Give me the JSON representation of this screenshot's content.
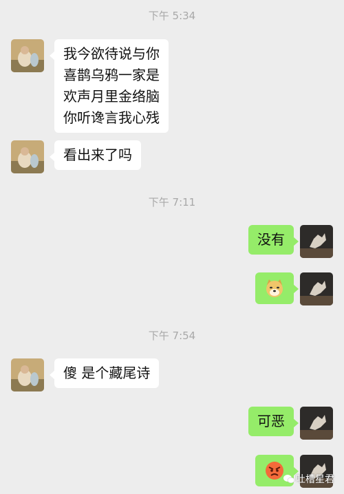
{
  "chat": {
    "timestamps": [
      "下午 5:34",
      "下午 7:11",
      "下午 7:54"
    ],
    "messages": [
      {
        "side": "in",
        "lines": [
          "我今欲待说与你",
          "喜鹊乌鸦一家是",
          "欢声月里金络脑",
          "你听谗言我心残"
        ]
      },
      {
        "side": "in",
        "lines": [
          "看出来了吗"
        ]
      },
      {
        "side": "out",
        "lines": [
          "没有"
        ]
      },
      {
        "side": "out",
        "sticker": "doge-emoji"
      },
      {
        "side": "in",
        "lines": [
          "傻 是个藏尾诗"
        ]
      },
      {
        "side": "out",
        "lines": [
          "可恶"
        ]
      },
      {
        "side": "out",
        "sticker": "angry-face-emoji"
      }
    ]
  },
  "watermark": {
    "text": "吐槽星君",
    "icon": "wechat-icon"
  },
  "colors": {
    "background": "#ededed",
    "incoming": "#ffffff",
    "outgoing": "#95ec69",
    "timestamp": "#a8a8a8"
  }
}
